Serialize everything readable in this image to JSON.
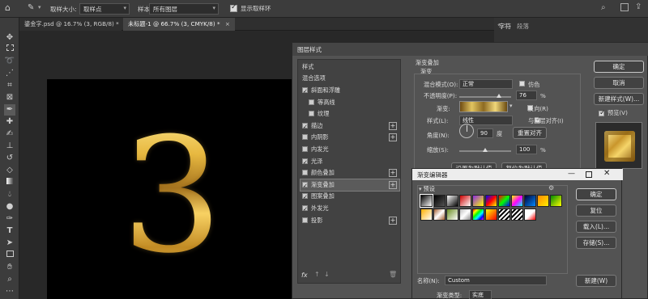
{
  "options_bar": {
    "sample_size_label": "取样大小:",
    "sample_size_value": "取样点",
    "sample_label": "样本:",
    "sample_value": "所有图层",
    "show_ring_label": "显示取样环"
  },
  "doc_tabs": [
    {
      "label": "鎏金字.psd @ 16.7% (3, RGB/8) *"
    },
    {
      "label": "未标题-1 @ 66.7% (3, CMYK/8) *"
    }
  ],
  "right_panel_tabs": [
    "字符",
    "段落"
  ],
  "canvas": {
    "glyph": "3"
  },
  "layer_style": {
    "title": "图层样式",
    "styles_header": "样式",
    "blend_options": "混合选项",
    "items": [
      {
        "label": "斜面和浮雕",
        "checked": true,
        "plus": false,
        "indent": false
      },
      {
        "label": "等高线",
        "checked": false,
        "plus": false,
        "indent": true
      },
      {
        "label": "纹理",
        "checked": false,
        "plus": false,
        "indent": true
      },
      {
        "label": "描边",
        "checked": true,
        "plus": true,
        "indent": false
      },
      {
        "label": "内阴影",
        "checked": false,
        "plus": true,
        "indent": false
      },
      {
        "label": "内发光",
        "checked": false,
        "plus": false,
        "indent": false
      },
      {
        "label": "光泽",
        "checked": true,
        "plus": false,
        "indent": false
      },
      {
        "label": "颜色叠加",
        "checked": false,
        "plus": true,
        "indent": false
      },
      {
        "label": "渐变叠加",
        "checked": true,
        "plus": true,
        "indent": false,
        "selected": true
      },
      {
        "label": "图案叠加",
        "checked": true,
        "plus": false,
        "indent": false
      },
      {
        "label": "外发光",
        "checked": true,
        "plus": false,
        "indent": false
      },
      {
        "label": "投影",
        "checked": false,
        "plus": true,
        "indent": false
      }
    ],
    "section_title": "渐变叠加",
    "subsection": "渐变",
    "blend_mode_label": "混合模式(O):",
    "blend_mode_value": "正常",
    "dither_label": "仿色",
    "opacity_label": "不透明度(P):",
    "opacity_value": "76",
    "opacity_fraction": 0.76,
    "percent": "%",
    "gradient_label": "渐变:",
    "reverse_label": "反向(R)",
    "style_label": "样式(L):",
    "style_value": "线性",
    "align_label": "与图层对齐(I)",
    "angle_label": "角度(N):",
    "angle_value": "90",
    "degree": "度",
    "reset_align": "重置对齐",
    "scale_label": "缩放(S):",
    "scale_value": "100",
    "scale_fraction": 0.5,
    "make_default": "设置为默认值",
    "reset_default": "复位为默认值",
    "ok": "确定",
    "cancel": "取消",
    "new_style": "新建样式(W)...",
    "preview": "预览(V)",
    "fx": "fx"
  },
  "gradient_editor": {
    "title": "渐变编辑器",
    "presets_label": "预设",
    "ok": "确定",
    "reset": "复位",
    "load": "载入(L)...",
    "save": "存储(S)...",
    "name_label": "名称(N):",
    "name_value": "Custom",
    "new_btn": "新建(W)",
    "type_label": "渐变类型:",
    "type_value": "实底",
    "min_icon": "minimize-icon",
    "max_icon": "maximize-icon",
    "close_icon": "close-icon"
  },
  "colors": {
    "gold": "#c9a23a",
    "panel": "#535353",
    "canvas": "#000000"
  }
}
